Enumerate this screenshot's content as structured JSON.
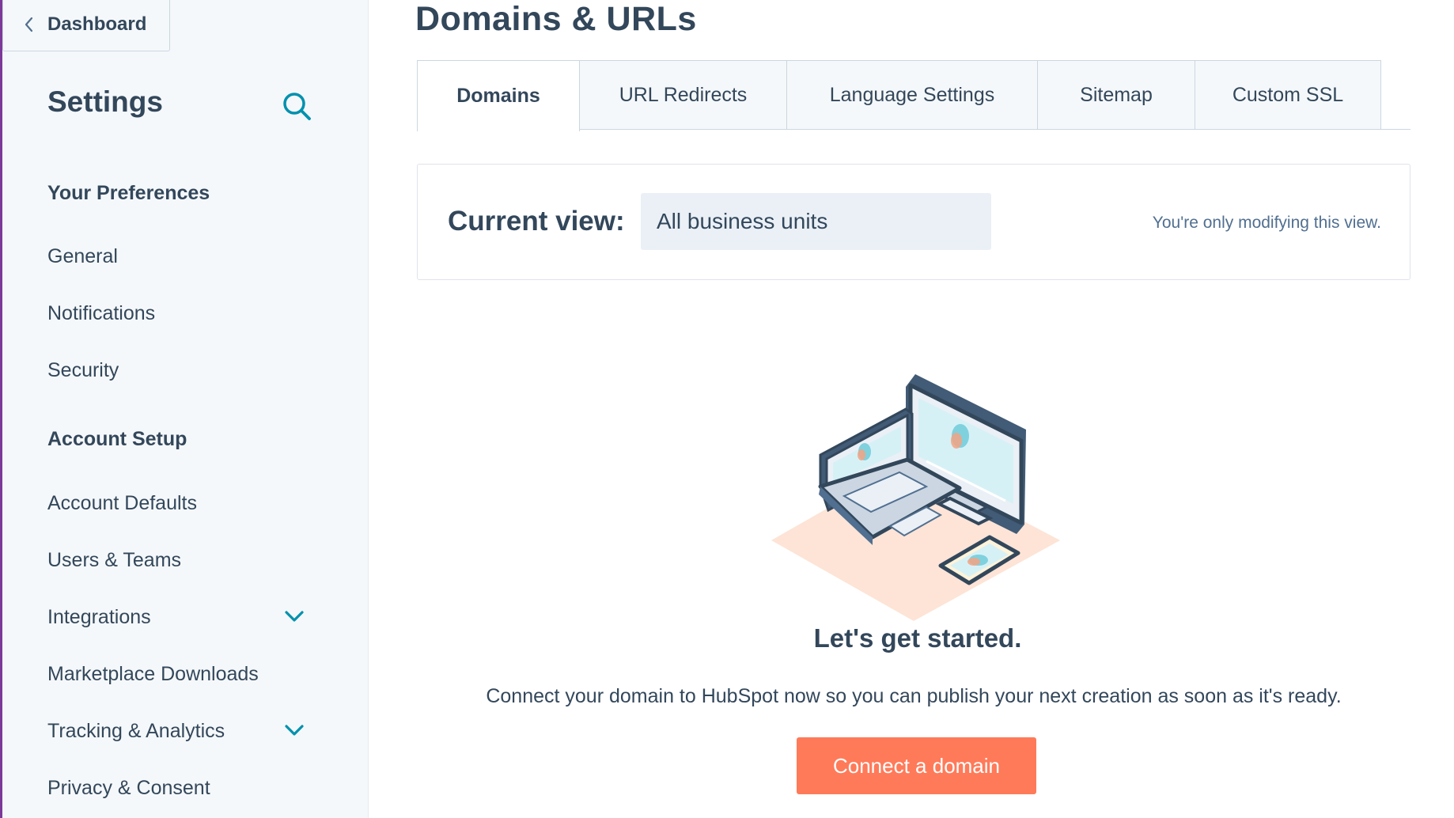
{
  "sidebar": {
    "back_label": "Dashboard",
    "title": "Settings",
    "sections": [
      {
        "heading": "Your Preferences",
        "items": [
          "General",
          "Notifications",
          "Security"
        ]
      },
      {
        "heading": "Account Setup",
        "items": [
          "Account Defaults",
          "Users & Teams",
          "Integrations",
          "Marketplace Downloads",
          "Tracking & Analytics",
          "Privacy & Consent"
        ]
      }
    ]
  },
  "main": {
    "title": "Domains & URLs",
    "tabs": [
      {
        "label": "Domains",
        "active": true
      },
      {
        "label": "URL Redirects",
        "active": false
      },
      {
        "label": "Language Settings",
        "active": false
      },
      {
        "label": "Sitemap",
        "active": false
      },
      {
        "label": "Custom SSL",
        "active": false
      }
    ],
    "current_view": {
      "label": "Current view:",
      "selected": "All business units",
      "note": "You're only modifying this view."
    },
    "empty_state": {
      "title": "Let's get started.",
      "text": "Connect your domain to HubSpot now so you can publish your next creation as soon as it's ready.",
      "button": "Connect a domain"
    }
  },
  "colors": {
    "accent": "#ff7a59",
    "teal": "#0091ae",
    "text": "#33475b",
    "sidebar_bg": "#f5f8fa",
    "edge": "#7c3a98"
  },
  "icons": {
    "back": "chevron-left-icon",
    "search": "search-icon",
    "expand": "chevron-down-icon"
  }
}
